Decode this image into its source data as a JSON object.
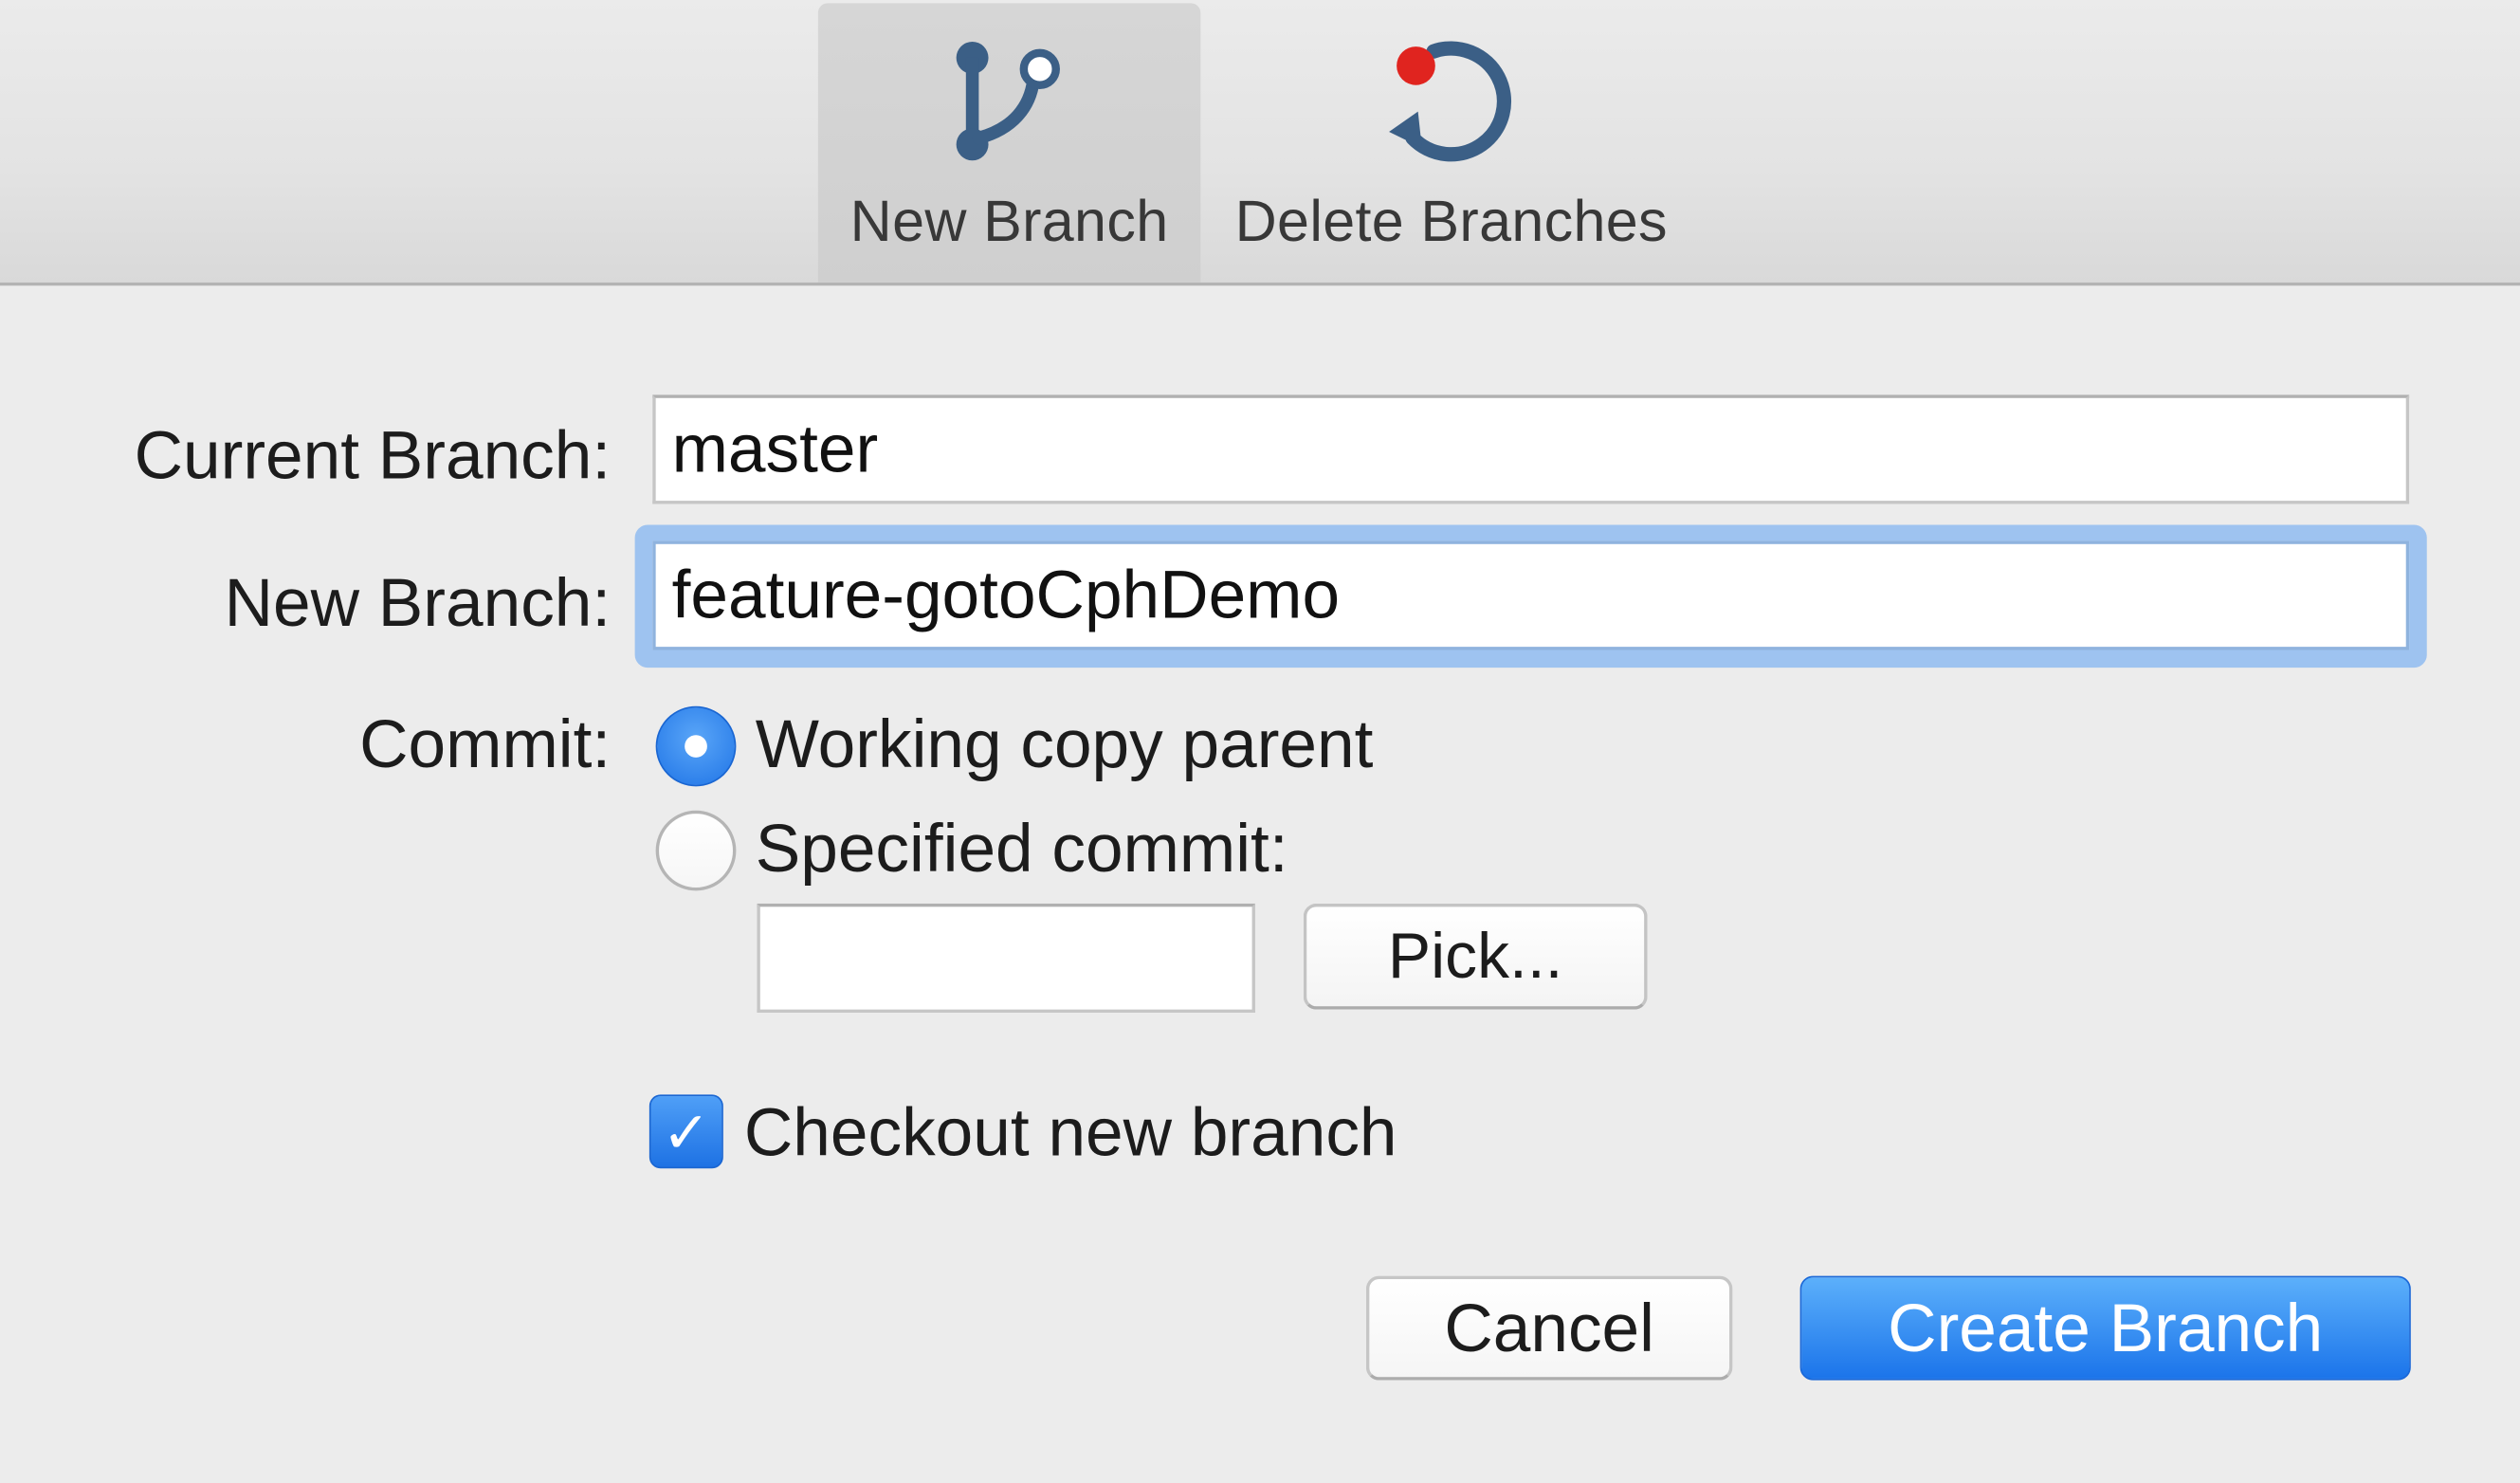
{
  "toolbar": {
    "items": [
      {
        "label": "New Branch",
        "icon": "branch-icon",
        "selected": true
      },
      {
        "label": "Delete Branches",
        "icon": "delete-branches-icon",
        "selected": false
      }
    ]
  },
  "form": {
    "current_branch": {
      "label": "Current Branch:",
      "value": "master"
    },
    "new_branch": {
      "label": "New Branch:",
      "value": "feature-gotoCphDemo"
    },
    "commit": {
      "label": "Commit:",
      "options": [
        {
          "label": "Working copy parent",
          "selected": true
        },
        {
          "label": "Specified commit:",
          "selected": false
        }
      ],
      "specified_value": "",
      "pick_label": "Pick..."
    },
    "checkout": {
      "label": "Checkout new branch",
      "checked": true
    }
  },
  "buttons": {
    "cancel": "Cancel",
    "create": "Create Branch"
  },
  "colors": {
    "accent": "#1f74e6",
    "focus_ring": "#9ec3f0",
    "delete_dot": "#e0241f",
    "icon_blue": "#3b5f86"
  }
}
